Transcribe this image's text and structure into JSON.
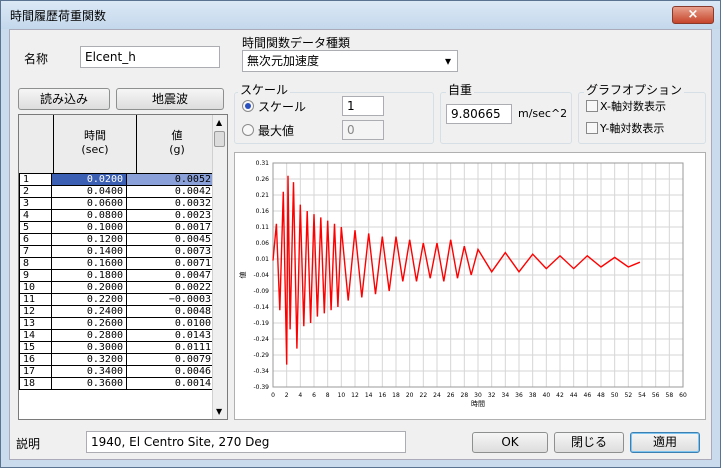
{
  "window": {
    "title": "時間履歴荷重関数",
    "close_symbol": "×"
  },
  "name_label": "名称",
  "name_value": "Elcent_h",
  "time_data_label": "時間関数データ種類",
  "time_data_value": "無次元加速度",
  "load_button": "読み込み",
  "quake_button": "地震波",
  "table": {
    "col_time": "時間",
    "col_time_unit": "(sec)",
    "col_value": "値",
    "col_value_unit": "(g)",
    "rows": [
      {
        "n": "1",
        "t": "0.0200",
        "v": "0.0052"
      },
      {
        "n": "2",
        "t": "0.0400",
        "v": "0.0042"
      },
      {
        "n": "3",
        "t": "0.0600",
        "v": "0.0032"
      },
      {
        "n": "4",
        "t": "0.0800",
        "v": "0.0023"
      },
      {
        "n": "5",
        "t": "0.1000",
        "v": "0.0017"
      },
      {
        "n": "6",
        "t": "0.1200",
        "v": "0.0045"
      },
      {
        "n": "7",
        "t": "0.1400",
        "v": "0.0073"
      },
      {
        "n": "8",
        "t": "0.1600",
        "v": "0.0071"
      },
      {
        "n": "9",
        "t": "0.1800",
        "v": "0.0047"
      },
      {
        "n": "10",
        "t": "0.2000",
        "v": "0.0022"
      },
      {
        "n": "11",
        "t": "0.2200",
        "v": "−0.0003"
      },
      {
        "n": "12",
        "t": "0.2400",
        "v": "0.0048"
      },
      {
        "n": "13",
        "t": "0.2600",
        "v": "0.0100"
      },
      {
        "n": "14",
        "t": "0.2800",
        "v": "0.0143"
      },
      {
        "n": "15",
        "t": "0.3000",
        "v": "0.0111"
      },
      {
        "n": "16",
        "t": "0.3200",
        "v": "0.0079"
      },
      {
        "n": "17",
        "t": "0.3400",
        "v": "0.0046"
      },
      {
        "n": "18",
        "t": "0.3600",
        "v": "0.0014"
      }
    ]
  },
  "scale": {
    "group_label": "スケール",
    "opt_scale": "スケール",
    "opt_max": "最大値",
    "scale_value": "1",
    "max_value": "0"
  },
  "weight": {
    "group_label": "自重",
    "value": "9.80665",
    "unit": "m/sec^2"
  },
  "graph_options": {
    "group_label": "グラフオプション",
    "x_log": "X-軸対数表示",
    "y_log": "Y-軸対数表示"
  },
  "description_label": "説明",
  "description_value": "1940, El Centro Site, 270 Deg",
  "buttons": {
    "ok": "OK",
    "close": "閉じる",
    "apply": "適用"
  },
  "chart_data": {
    "type": "line",
    "xlabel": "時間",
    "ylabel": "値",
    "xlim": [
      0,
      60
    ],
    "ylim": [
      -0.39,
      0.31
    ],
    "x_ticks": [
      "0",
      "2",
      "4",
      "6",
      "8",
      "10",
      "12",
      "14",
      "16",
      "18",
      "20",
      "22",
      "24",
      "26",
      "28",
      "30",
      "32",
      "34",
      "36",
      "38",
      "40",
      "42",
      "44",
      "46",
      "48",
      "50",
      "52",
      "54",
      "56",
      "58",
      "60"
    ],
    "y_ticks": [
      "0.31",
      "0.26",
      "0.21",
      "0.16",
      "0.11",
      "0.06",
      "0.01",
      "-0.04",
      "-0.09",
      "-0.14",
      "-0.19",
      "-0.24",
      "-0.29",
      "-0.34",
      "-0.39"
    ],
    "series_color": "#ff0000",
    "grid": true,
    "series": [
      {
        "x": [
          0,
          0.5,
          1,
          1.5,
          2,
          2.2,
          2.5,
          3,
          3.5,
          4,
          4.5,
          5,
          5.5,
          6,
          6.5,
          7,
          7.5,
          8,
          8.5,
          9,
          9.5,
          10,
          11,
          12,
          13,
          14,
          15,
          16,
          17,
          18,
          19,
          20,
          21,
          22,
          23,
          24,
          25,
          26,
          27,
          28,
          29,
          30,
          32,
          34,
          36,
          38,
          40,
          42,
          44,
          46,
          48,
          50,
          52,
          53.7
        ],
        "y": [
          0.005,
          0.12,
          -0.15,
          0.22,
          -0.32,
          0.27,
          -0.21,
          0.25,
          -0.27,
          0.18,
          -0.2,
          0.16,
          -0.19,
          0.15,
          -0.17,
          0.14,
          -0.16,
          0.13,
          -0.15,
          0.12,
          -0.14,
          0.11,
          -0.12,
          0.1,
          -0.11,
          0.09,
          -0.1,
          0.08,
          -0.09,
          0.08,
          -0.06,
          0.07,
          -0.06,
          0.06,
          -0.05,
          0.06,
          -0.06,
          0.07,
          -0.05,
          0.05,
          -0.04,
          0.04,
          -0.03,
          0.03,
          -0.03,
          0.025,
          -0.02,
          0.02,
          -0.02,
          0.02,
          -0.015,
          0.015,
          -0.015,
          0.0
        ]
      }
    ]
  }
}
